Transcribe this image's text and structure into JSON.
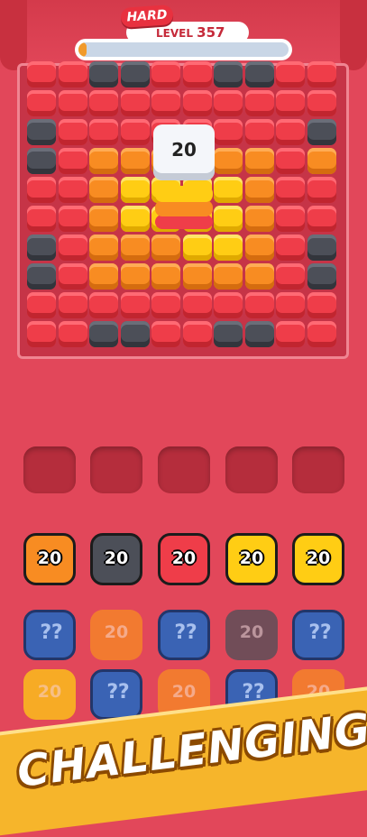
{
  "header": {
    "difficulty": "HARD",
    "level_label": "LEVEL",
    "level_number": "357",
    "progress": 0.04
  },
  "colors": {
    "red": "#ef3d49",
    "dark": "#4c4f58",
    "orange": "#f88c22",
    "yellow": "#ffcd14",
    "mystery": "#3a63b4"
  },
  "board": {
    "rows": [
      "rrddrrddrr",
      "rrrrrrrrrr",
      "drrrrrrrrd",
      "drooooooro",
      "rroyyyyorr",
      "rroyyyyorr",
      "droooyyord",
      "droooooord",
      "rrrrrrrrrr",
      "rrddrrddrr"
    ],
    "stack_count": "20"
  },
  "tray": {
    "slots": 5
  },
  "picks": [
    {
      "color": "orange",
      "label": "20"
    },
    {
      "color": "dark",
      "label": "20"
    },
    {
      "color": "red",
      "label": "20"
    },
    {
      "color": "yellow",
      "label": "20"
    },
    {
      "color": "yellow",
      "label": "20"
    }
  ],
  "queue_row1": [
    {
      "type": "mystery",
      "label": ""
    },
    {
      "type": "orange",
      "label": "20"
    },
    {
      "type": "mystery",
      "label": ""
    },
    {
      "type": "dark",
      "label": "20"
    },
    {
      "type": "mystery",
      "label": ""
    }
  ],
  "queue_row2": [
    {
      "type": "yellow",
      "label": "20"
    },
    {
      "type": "mystery",
      "label": ""
    },
    {
      "type": "orange",
      "label": "20"
    },
    {
      "type": "mystery",
      "label": ""
    },
    {
      "type": "orange",
      "label": "20"
    }
  ],
  "banner": {
    "text": "CHALLENGING"
  }
}
